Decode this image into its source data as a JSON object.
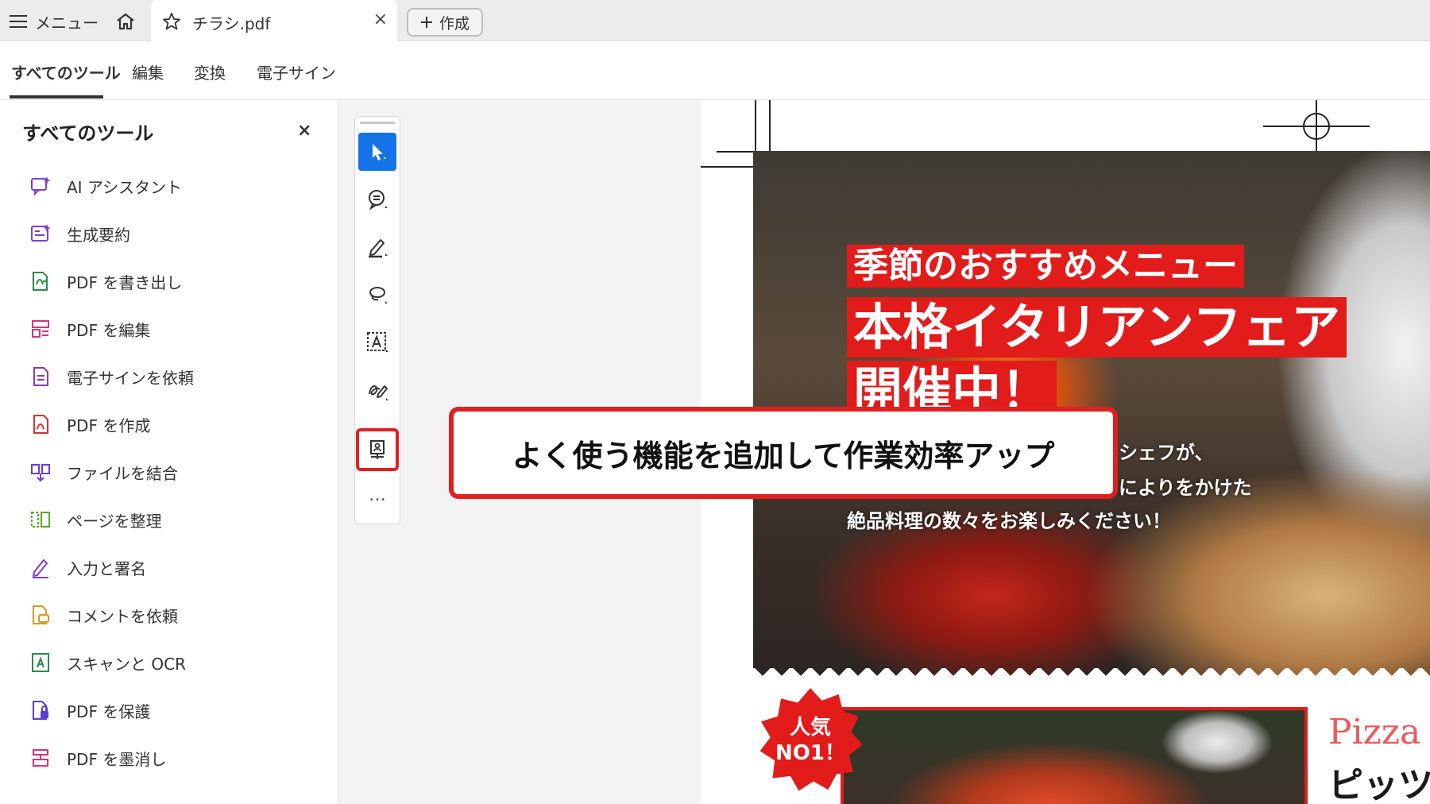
{
  "titlebar": {
    "menu_label": "メニュー",
    "tab_title": "チラシ.pdf",
    "tab_close": "×",
    "create_label": "作成"
  },
  "tooltabs": [
    {
      "label": "すべてのツール",
      "active": true
    },
    {
      "label": "編集"
    },
    {
      "label": "変換"
    },
    {
      "label": "電子サイン"
    }
  ],
  "panel": {
    "title": "すべてのツール",
    "close": "×",
    "items": [
      {
        "label": "AI アシスタント",
        "icon": "ai-assistant-icon",
        "color": "#7b3fd1"
      },
      {
        "label": "生成要約",
        "icon": "generative-summary-icon",
        "color": "#7b3fd1"
      },
      {
        "label": "PDF を書き出し",
        "icon": "export-pdf-icon",
        "color": "#2b8a4a"
      },
      {
        "label": "PDF を編集",
        "icon": "edit-pdf-icon",
        "color": "#d6337a"
      },
      {
        "label": "電子サインを依頼",
        "icon": "request-esign-icon",
        "color": "#8a3bb5"
      },
      {
        "label": "PDF を作成",
        "icon": "create-pdf-icon",
        "color": "#d63333"
      },
      {
        "label": "ファイルを結合",
        "icon": "combine-files-icon",
        "color": "#6b3fd1"
      },
      {
        "label": "ページを整理",
        "icon": "organize-pages-icon",
        "color": "#5aa832"
      },
      {
        "label": "入力と署名",
        "icon": "fill-sign-icon",
        "color": "#7b3fd1"
      },
      {
        "label": "コメントを依頼",
        "icon": "request-comments-icon",
        "color": "#d69a1f"
      },
      {
        "label": "スキャンと OCR",
        "icon": "scan-ocr-icon",
        "color": "#2b8a4a"
      },
      {
        "label": "PDF を保護",
        "icon": "protect-pdf-icon",
        "color": "#5a3fd1"
      },
      {
        "label": "PDF を墨消し",
        "icon": "redact-pdf-icon",
        "color": "#d6337a"
      }
    ]
  },
  "quicktools": [
    {
      "name": "select-tool",
      "icon": "cursor-icon",
      "selected": true
    },
    {
      "name": "comment-tool",
      "icon": "comment-icon"
    },
    {
      "name": "highlight-tool",
      "icon": "pen-icon"
    },
    {
      "name": "draw-tool",
      "icon": "lasso-icon"
    },
    {
      "name": "text-recognition-tool",
      "icon": "text-select-icon"
    },
    {
      "name": "sign-tool",
      "icon": "signature-icon"
    },
    {
      "name": "stamp-tool",
      "icon": "stamp-icon",
      "highlighted": true
    }
  ],
  "quick_more": "…",
  "flyer": {
    "label1": "季節のおすすめメニュー",
    "label2": "本格イタリアンフェア",
    "label3": "開催中！",
    "text1": "シェフが、",
    "text2": "によりをかけた",
    "text3": "絶品料理の数々をお楽しみください！",
    "badge_line1": "人気",
    "badge_line2": "NO1！",
    "pizza_word": "Pizza",
    "pizza_jp": "ピッツ"
  },
  "callout": {
    "text": "よく使う機能を追加して作業効率アップ"
  },
  "colors": {
    "accent_blue": "#1473e6",
    "highlight_red": "#e02020",
    "flyer_red": "#e21b1b"
  }
}
